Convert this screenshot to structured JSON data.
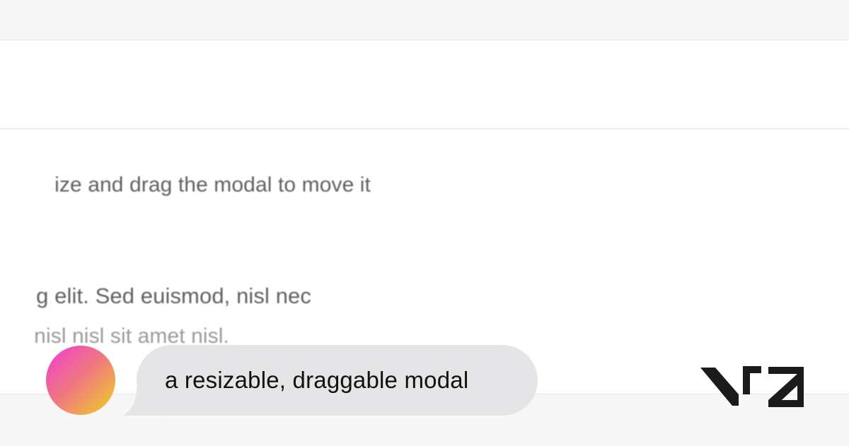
{
  "modal": {
    "instruction": "ize and drag the modal to move it",
    "body_line_1": "g elit. Sed euismod, nisl nec",
    "body_line_2": "nisl nisl sit amet nisl."
  },
  "prompt": {
    "text": "a resizable, draggable modal"
  },
  "brand": {
    "logo_label": "v0"
  },
  "colors": {
    "avatar_gradient": [
      "#f03bd4",
      "#f07b7c",
      "#efd223"
    ],
    "bubble": "#e5e5e7",
    "logo": "#1b1b1b"
  }
}
